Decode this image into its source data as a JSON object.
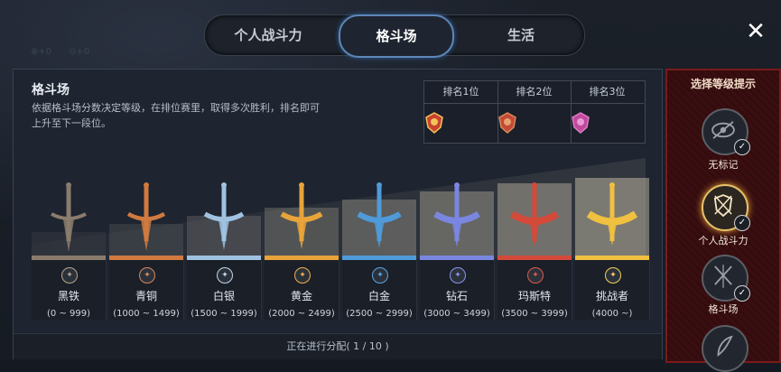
{
  "tabs": [
    {
      "label": "个人战斗力"
    },
    {
      "label": "格斗场"
    },
    {
      "label": "生活"
    }
  ],
  "ghost": {
    "stat_a": "+0",
    "stat_b": "+0"
  },
  "panel": {
    "title": "格斗场",
    "description": "依据格斗场分数决定等级，在排位赛里，取得多次胜利，排名即可上升至下一段位。",
    "ranks": [
      {
        "label": "排名1位",
        "color": "#c8432f"
      },
      {
        "label": "排名2位",
        "color": "#c24a36"
      },
      {
        "label": "排名3位",
        "color": "#c04a9a"
      }
    ],
    "tiers": [
      {
        "name": "黑铁",
        "range": "(0 ~ 999)",
        "bar_color": "#8a7c6c",
        "emblem_color": "#b8a48a",
        "emblem": "icon-iron"
      },
      {
        "name": "青铜",
        "range": "(1000 ~ 1499)",
        "bar_color": "#d07a40",
        "emblem_color": "#d9885a",
        "emblem": "icon-bronze"
      },
      {
        "name": "白银",
        "range": "(1500 ~ 1999)",
        "bar_color": "#9fc2e0",
        "emblem_color": "#c5d6e8",
        "emblem": "icon-silver"
      },
      {
        "name": "黄金",
        "range": "(2000 ~ 2499)",
        "bar_color": "#e8a33a",
        "emblem_color": "#f0b04a",
        "emblem": "icon-gold"
      },
      {
        "name": "白金",
        "range": "(2500 ~ 2999)",
        "bar_color": "#4f9ad8",
        "emblem_color": "#5aa7e4",
        "emblem": "icon-platinum"
      },
      {
        "name": "钻石",
        "range": "(3000 ~ 3499)",
        "bar_color": "#7a86e0",
        "emblem_color": "#8a96f0",
        "emblem": "icon-diamond"
      },
      {
        "name": "玛斯特",
        "range": "(3500 ~ 3999)",
        "bar_color": "#d44a3a",
        "emblem_color": "#e05a48",
        "emblem": "icon-master"
      },
      {
        "name": "挑战者",
        "range": "(4000 ~)",
        "bar_color": "#f0c040",
        "emblem_color": "#f4cf58",
        "emblem": "icon-challenger"
      }
    ],
    "footer": "正在进行分配( 1 / 10 )"
  },
  "side": {
    "title": "选择等级提示",
    "options": [
      {
        "label": "无标记",
        "icon": "eye-off-icon",
        "active": false
      },
      {
        "label": "个人战斗力",
        "icon": "shield-swords-icon",
        "active": true
      },
      {
        "label": "格斗场",
        "icon": "crossed-swords-icon",
        "active": false
      }
    ]
  },
  "close_icon": "close-icon"
}
